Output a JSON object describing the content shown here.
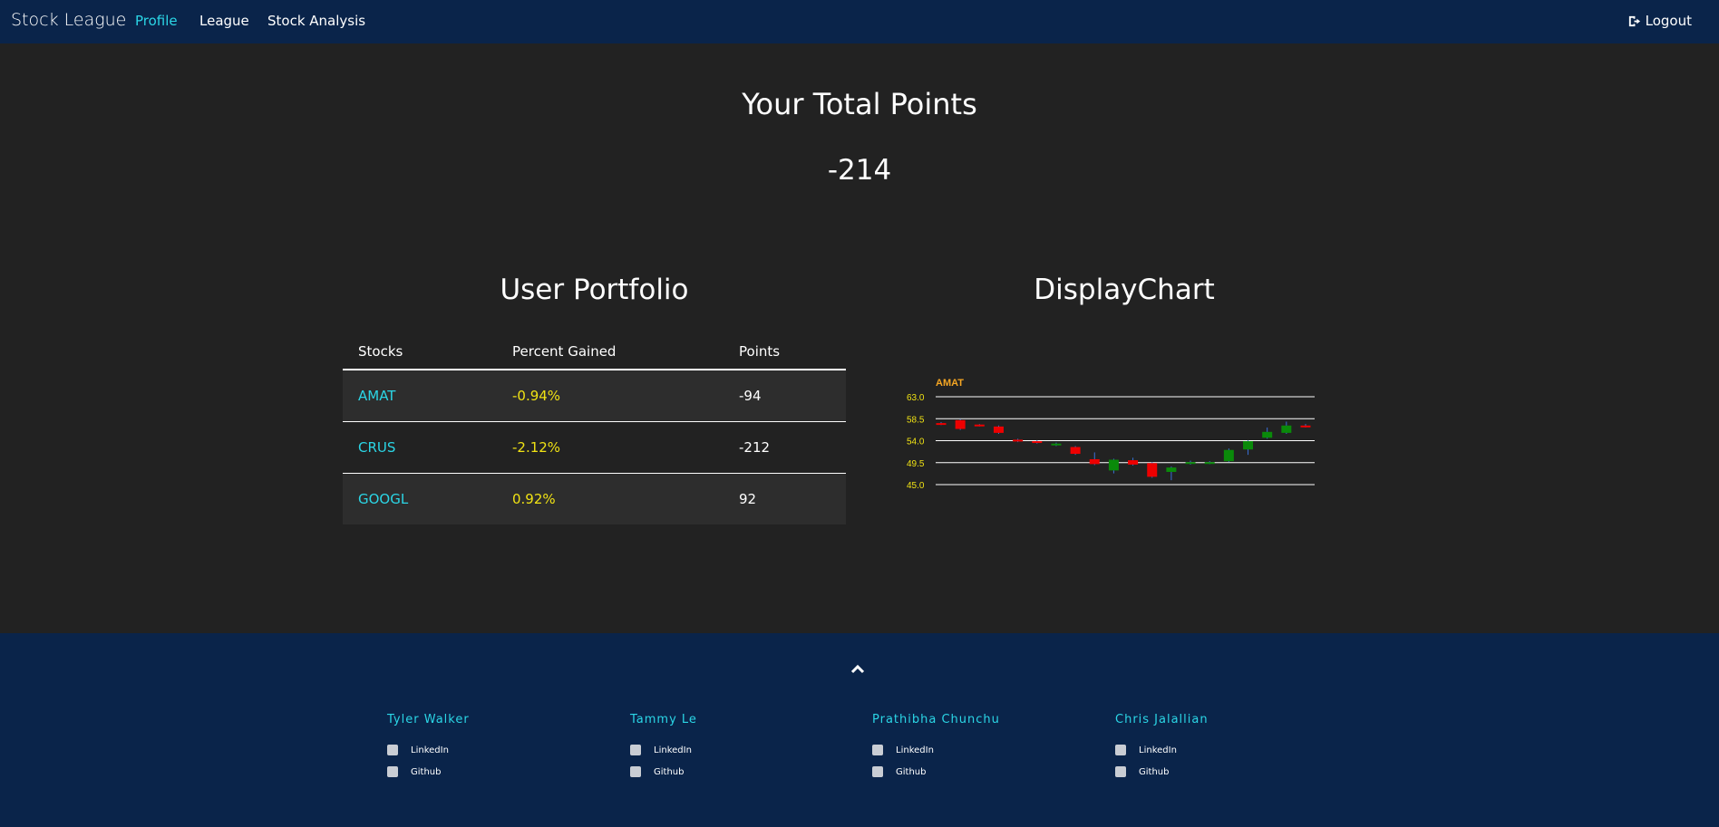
{
  "navbar": {
    "brand": "Stock League",
    "links": [
      "Profile",
      "League",
      "Stock Analysis"
    ],
    "logout": "Logout"
  },
  "points": {
    "title": "Your Total Points",
    "value": "-214"
  },
  "portfolio": {
    "title": "User Portfolio",
    "headers": [
      "Stocks",
      "Percent Gained",
      "Points"
    ],
    "rows": [
      {
        "stock": "AMAT",
        "percent": "-0.94%",
        "points": "-94"
      },
      {
        "stock": "CRUS",
        "percent": "-2.12%",
        "points": "-212"
      },
      {
        "stock": "GOOGL",
        "percent": "0.92%",
        "points": "92"
      }
    ]
  },
  "display_chart": {
    "title": "DisplayChart"
  },
  "chart_data": {
    "type": "candlestick",
    "title": "AMAT",
    "y_ticks": [
      "63.0",
      "58.5",
      "54.0",
      "49.5",
      "45.0"
    ],
    "ylim": [
      45.0,
      63.0
    ],
    "candles": [
      {
        "open": 57.6,
        "close": 57.4,
        "high": 57.8,
        "low": 57.2
      },
      {
        "open": 58.2,
        "close": 56.4,
        "high": 58.4,
        "low": 56.2
      },
      {
        "open": 57.3,
        "close": 57.1,
        "high": 57.4,
        "low": 56.9
      },
      {
        "open": 56.9,
        "close": 55.6,
        "high": 57.1,
        "low": 55.4
      },
      {
        "open": 54.2,
        "close": 53.9,
        "high": 54.4,
        "low": 53.7
      },
      {
        "open": 53.9,
        "close": 53.6,
        "high": 54.1,
        "low": 53.4
      },
      {
        "open": 53.1,
        "close": 53.4,
        "high": 53.6,
        "low": 52.9
      },
      {
        "open": 52.7,
        "close": 51.3,
        "high": 52.9,
        "low": 51.1
      },
      {
        "open": 50.2,
        "close": 49.2,
        "high": 51.6,
        "low": 49.0
      },
      {
        "open": 47.9,
        "close": 50.1,
        "high": 50.3,
        "low": 47.3
      },
      {
        "open": 50.0,
        "close": 49.1,
        "high": 50.5,
        "low": 48.9
      },
      {
        "open": 49.4,
        "close": 46.6,
        "high": 49.6,
        "low": 46.4
      },
      {
        "open": 47.6,
        "close": 48.5,
        "high": 48.7,
        "low": 45.9
      },
      {
        "open": 49.3,
        "close": 49.6,
        "high": 49.9,
        "low": 49.1
      },
      {
        "open": 49.4,
        "close": 49.6,
        "high": 49.8,
        "low": 49.2
      },
      {
        "open": 49.8,
        "close": 52.1,
        "high": 52.4,
        "low": 49.6
      },
      {
        "open": 52.2,
        "close": 53.9,
        "high": 54.1,
        "low": 51.1
      },
      {
        "open": 54.6,
        "close": 55.8,
        "high": 56.7,
        "low": 54.4
      },
      {
        "open": 55.6,
        "close": 57.1,
        "high": 57.9,
        "low": 55.4
      },
      {
        "open": 57.1,
        "close": 56.9,
        "high": 57.4,
        "low": 56.7
      }
    ],
    "colors": {
      "up": "#0a8a0a",
      "down": "#ee0000",
      "wick": "#3a6fd8",
      "title": "#f5a623",
      "ticks": "#f0e214",
      "grid": "#ffffff"
    }
  },
  "footer": {
    "members": [
      {
        "name": "Tyler Walker",
        "linkedin": "LinkedIn",
        "github": "Github"
      },
      {
        "name": "Tammy Le",
        "linkedin": "LinkedIn",
        "github": "Github"
      },
      {
        "name": "Prathibha Chunchu",
        "linkedin": "LinkedIn",
        "github": "Github"
      },
      {
        "name": "Chris Jalallian",
        "linkedin": "LinkedIn",
        "github": "Github"
      }
    ]
  }
}
